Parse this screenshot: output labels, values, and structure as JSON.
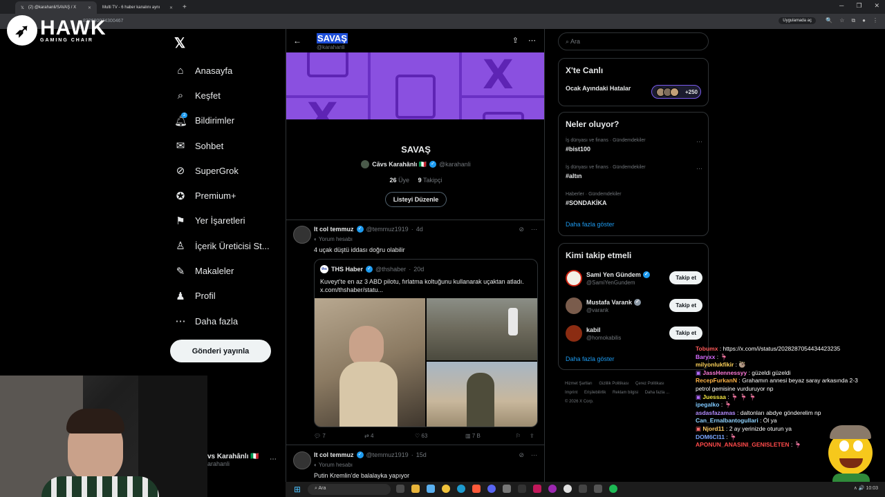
{
  "browser": {
    "tabs": [
      {
        "label": "(2) @karahanli/SAVAŞ / X",
        "active": true
      },
      {
        "label": "Multi TV - 6 haber kanalını aynı",
        "active": false
      }
    ],
    "url": "822690074300467",
    "app_open_label": "Uygulamada aç"
  },
  "overlay_logo": {
    "brand": "HAWK",
    "sub": "GAMING CHAIR"
  },
  "sidebar": {
    "items": [
      {
        "label": "Anasayfa",
        "icon": "home-icon"
      },
      {
        "label": "Keşfet",
        "icon": "search-icon"
      },
      {
        "label": "Bildirimler",
        "icon": "bell-icon",
        "badge": "2"
      },
      {
        "label": "Sohbet",
        "icon": "mail-icon"
      },
      {
        "label": "SuperGrok",
        "icon": "grok-icon"
      },
      {
        "label": "Premium+",
        "icon": "premium-icon"
      },
      {
        "label": "Yer İşaretleri",
        "icon": "bookmark-icon"
      },
      {
        "label": "İçerik Üreticisi St...",
        "icon": "creator-icon"
      },
      {
        "label": "Makaleler",
        "icon": "article-icon"
      },
      {
        "label": "Profil",
        "icon": "profile-icon"
      },
      {
        "label": "Daha fazla",
        "icon": "more-icon"
      }
    ],
    "post_button": "Gönderi yayınla",
    "account": {
      "name": "vs Karahânlı 🇮🇹",
      "handle": "arahanli"
    }
  },
  "list": {
    "title": "SAVAŞ",
    "handle": "@karahanli",
    "name": "SAVAŞ",
    "owner_name": "Cāvs Karahânlı 🇮🇹",
    "owner_handle": "@karahanli",
    "members_count": "26",
    "members_label": "Üye",
    "followers_count": "9",
    "followers_label": "Takipçi",
    "edit_button": "Listeyi Düzenle"
  },
  "tweets": [
    {
      "author": "lt col temmuz",
      "handle": "@temmuz1919",
      "time": "4d",
      "sub": "Yorum hesabı",
      "text": "4 uçak düştü iddası doğru olabilir",
      "quote": {
        "author": "THS Haber",
        "handle": "@thshaber",
        "time": "20d",
        "logo": "ths",
        "text": "Kuveyt’te en az 3 ABD pilotu, fırlatma koltuğunu kullanarak uçaktan atladı.  x.com/thshaber/statu..."
      },
      "replies": "7",
      "retweets": "4",
      "likes": "63",
      "views": "7 B"
    },
    {
      "author": "lt col temmuz",
      "handle": "@temmuz1919",
      "time": "15d",
      "sub": "Yorum hesabı",
      "text": "Putin Kremlin’de balalayka yapıyor"
    }
  ],
  "right": {
    "search_placeholder": "Ara",
    "live": {
      "title": "X'te Canlı",
      "topic": "Ocak Ayındaki Hatalar",
      "count": "+250"
    },
    "trends_title": "Neler oluyor?",
    "trends": [
      {
        "category": "İş dünyası ve finans · Gündemdekiler",
        "name": "#bist100"
      },
      {
        "category": "İş dünyası ve finans · Gündemdekiler",
        "name": "#altın"
      },
      {
        "category": "Haberler · Gündemdekiler",
        "name": "#SONDAKİKA"
      }
    ],
    "show_more": "Daha fazla göster",
    "who_title": "Kimi takip etmeli",
    "who": [
      {
        "name": "Sami Yen Gündem",
        "handle": "@SamiYenGundem",
        "verified": true
      },
      {
        "name": "Mustafa Varank",
        "handle": "@varank",
        "verified": true
      },
      {
        "name": "kabil",
        "handle": "@homokabilis",
        "verified": false
      }
    ],
    "follow_label": "Takip et",
    "who_show_more": "Daha fazla göster",
    "footer": [
      "Hizmet Şartları",
      "Gizlilik Politikası",
      "Çerez Politikası",
      "Imprint",
      "Erişilebilirlik",
      "Reklam bilgisi",
      "Daha fazla ...",
      "© 2026 X Corp."
    ]
  },
  "chat": [
    {
      "user": "Tobumx",
      "text": ": https://x.com/i/status/2028287054434423235",
      "color": "#ff5a5a"
    },
    {
      "user": "Baryxx",
      "text": ": 🦩",
      "color": "#d86cff"
    },
    {
      "user": "milyonlukfikir",
      "text": ": 🦥",
      "color": "#ffd35a"
    },
    {
      "user": "JassHennessyy",
      "text": ": güzeldi güzeldi",
      "color": "#ff7ad9"
    },
    {
      "user": "RecepFurkanN",
      "text": ": Grahamın annesi beyaz saray arkasında 2-3",
      "color": "#ffb347"
    },
    {
      "user": "",
      "text": "petrol gemisine vurduruyor np",
      "color": "#ffffff"
    },
    {
      "user": "Juessaa",
      "text": ": 🦩 🦩 🦩",
      "color": "#f5e642"
    },
    {
      "user": "ipegalko",
      "text": ": 🦩",
      "color": "#7ec8ff"
    },
    {
      "user": "asdasfazamas",
      "text": ": daltonları abdye gönderelim np",
      "color": "#b48cff"
    },
    {
      "user": "Can_Ernalbantogullari",
      "text": ": Öl ya",
      "color": "#8fd3ff"
    },
    {
      "user": "Njord11",
      "text": ": 2 ay yerinizde oturun ya",
      "color": "#ffcc66"
    },
    {
      "user": "DOM6CI11",
      "text": ": 🦩",
      "color": "#7aa6ff"
    },
    {
      "user": "APONUN_ANASINI_GENISLETEN",
      "text": ": 🦩",
      "color": "#ff4a4a"
    }
  ],
  "taskbar": {
    "search": "Ara",
    "tray": "∧ 🔊 10:03"
  }
}
